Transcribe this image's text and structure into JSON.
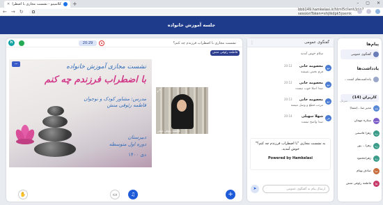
{
  "browser": {
    "tab_title": "کلاسینو - نشست مجازی با اضطراب",
    "url": "bbb149.hamkelasi.ir/html5client/join?sessionToken=xhjtkdpk5joemk"
  },
  "app": {
    "title": "جلسه آموزش خانواده"
  },
  "share": {
    "timer": "20:29",
    "slide_title": "نشست مجازی با اضطراب فرزندم چه کنم؟",
    "presenter": "فاطمه رئوفی منش",
    "slide": {
      "line1": "نشست مجازی آموزش خانواده",
      "line2": "با اضطراب فرزندم چه کنم",
      "line3": "مدرس: مشاور کودک و نوجوان",
      "line4": "فاطمه رئوفی منش",
      "line5": "دبیرستان",
      "line6": "دوره اول متوسطه",
      "line7": "دی ۱۴۰۰"
    },
    "video_name": "فاطمه رئوفی منش"
  },
  "chat": {
    "title": "گفتگوی عمومی",
    "messages": [
      {
        "name": "",
        "time": "",
        "text": "سلام خوش آمدید",
        "initial": "ف"
      },
      {
        "name": "معصومه خانی",
        "time": "20:12",
        "text": "فرم بخش نمیشه",
        "initial": "مع"
      },
      {
        "name": "معصومه خانی",
        "time": "20:12",
        "text": "صدا اصلا خوب نیست",
        "initial": "مع"
      },
      {
        "name": "معصومه خانی",
        "time": "20:13",
        "text": "مرتب قطع و وصل میشه",
        "initial": "مع"
      },
      {
        "name": "شهلا سهیلی",
        "time": "20:14",
        "text": "صدا واضح نیست",
        "initial": "ش"
      }
    ],
    "notice_text": "به نشست مجازی \"با اضطراب فرزندم چه کنم؟\" خوش آمدید.",
    "notice_powered": "Powered by Hamkelasi",
    "input_placeholder": "ارسال پیام به گفتگوی عمومی"
  },
  "sidebar": {
    "messages_title": "پیام‌ها",
    "public_chat": "گفتگوی عمومی",
    "notes_title": "یادداشت‌ها",
    "shared_notes": "یادداشت‌های اشت...",
    "users_title": "کاربران (14)",
    "users": [
      {
        "name": "مدیر صا...(شما)",
        "initial": "مد",
        "role": "میزبان"
      },
      {
        "name": "ستاره مهمان",
        "initial": "ست",
        "role": ""
      },
      {
        "name": "زهرا قاسمی",
        "initial": "زه",
        "role": ""
      },
      {
        "name": "زهرا... پور",
        "initial": "زه",
        "role": ""
      },
      {
        "name": "زهرامحمود",
        "initial": "زه",
        "role": ""
      },
      {
        "name": "صادق بهنام",
        "initial": "صا",
        "role": ""
      },
      {
        "name": "فاطمه رئوفی منش",
        "initial": "فا",
        "role": ""
      }
    ]
  }
}
